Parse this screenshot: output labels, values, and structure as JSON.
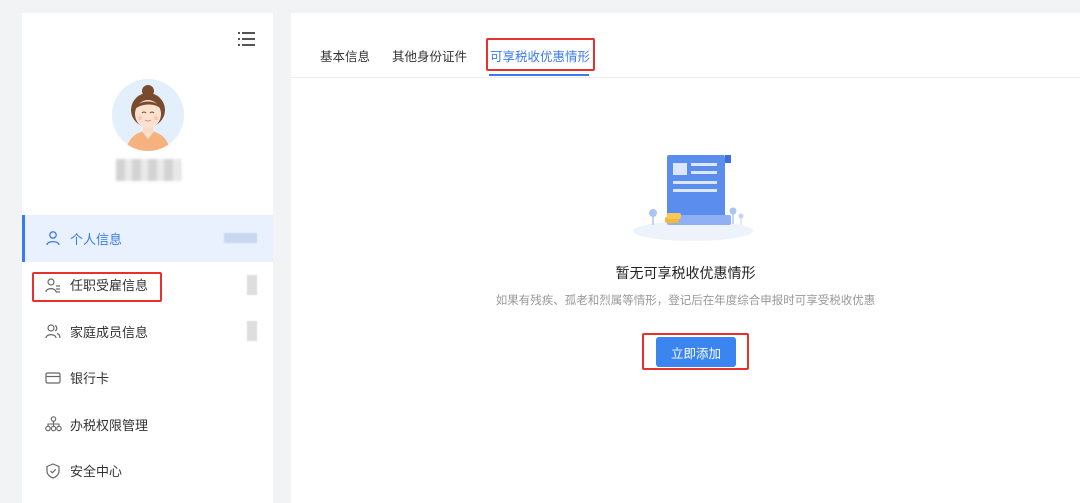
{
  "sidebar": {
    "items": [
      {
        "label": "个人信息",
        "icon": "user-icon",
        "active": true
      },
      {
        "label": "任职受雇信息",
        "icon": "user-list-icon",
        "active": false
      },
      {
        "label": "家庭成员信息",
        "icon": "family-icon",
        "active": false
      },
      {
        "label": "银行卡",
        "icon": "bank-card-icon",
        "active": false
      },
      {
        "label": "办税权限管理",
        "icon": "org-chart-icon",
        "active": false
      },
      {
        "label": "安全中心",
        "icon": "shield-icon",
        "active": false
      }
    ]
  },
  "tabs": [
    {
      "label": "基本信息"
    },
    {
      "label": "其他身份证件"
    },
    {
      "label": "可享税收优惠情形"
    }
  ],
  "empty_state": {
    "title": "暂无可享税收优惠情形",
    "description": "如果有残疾、孤老和烈属等情形，登记后在年度综合申报时可享受税收优惠",
    "button_label": "立即添加"
  },
  "colors": {
    "accent": "#3a7bf0",
    "highlight": "#e8302c",
    "active_bg": "#e8f1fd"
  }
}
